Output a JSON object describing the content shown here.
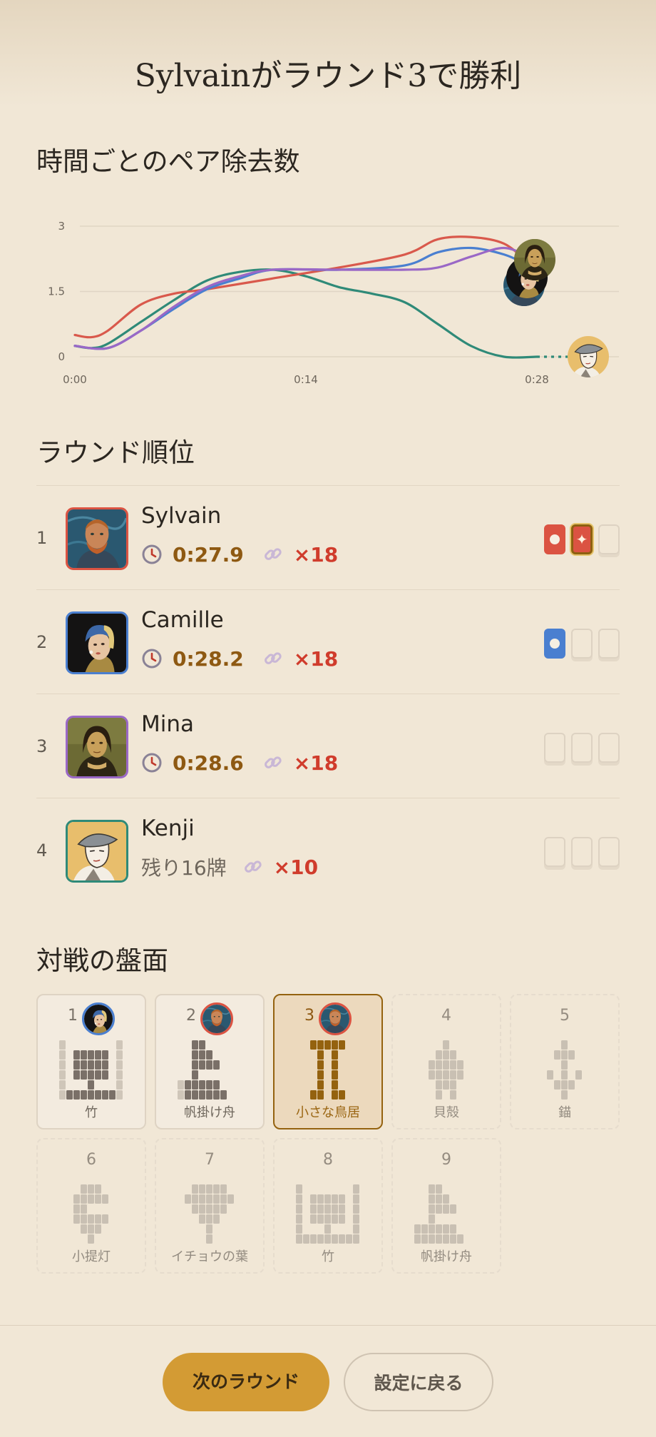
{
  "title": "Sylvainがラウンド3で勝利",
  "chart_section": {
    "heading": "時間ごとのペア除去数"
  },
  "chart_data": {
    "type": "line",
    "x_tick_labels": [
      "0:00",
      "0:14",
      "0:28"
    ],
    "y_tick_labels": [
      "0",
      "1.5",
      "3"
    ],
    "xlim": [
      0,
      28
    ],
    "ylim": [
      0,
      3
    ],
    "grid": true,
    "series": [
      {
        "player": "Sylvain",
        "color": "#d9594c",
        "x": [
          0,
          1,
          2,
          4,
          6,
          8,
          12,
          16,
          20,
          22,
          24,
          26,
          27.5
        ],
        "y": [
          0.5,
          0.45,
          0.6,
          1.2,
          1.45,
          1.55,
          1.8,
          2.05,
          2.35,
          2.7,
          2.75,
          2.6,
          2.15
        ]
      },
      {
        "player": "Camille",
        "color": "#4a7fd0",
        "x": [
          0,
          2,
          4,
          6,
          8,
          10,
          12,
          16,
          20,
          22,
          24,
          26,
          27.5
        ],
        "y": [
          0.25,
          0.2,
          0.6,
          1.1,
          1.55,
          1.8,
          2.0,
          2.0,
          2.1,
          2.4,
          2.5,
          2.35,
          2.1
        ]
      },
      {
        "player": "Mina",
        "color": "#9a68c6",
        "x": [
          0,
          2,
          4,
          6,
          8,
          10,
          12,
          16,
          20,
          22,
          24,
          26,
          27.5
        ],
        "y": [
          0.25,
          0.2,
          0.6,
          1.15,
          1.6,
          1.85,
          2.0,
          2.0,
          2.0,
          2.05,
          2.3,
          2.5,
          2.3
        ]
      },
      {
        "player": "Kenji",
        "color": "#2f8a78",
        "x": [
          0,
          1,
          2,
          4,
          6,
          8,
          10,
          12,
          14,
          16,
          18,
          20,
          22,
          24,
          26,
          28
        ],
        "y": [
          0.25,
          0.2,
          0.3,
          0.8,
          1.3,
          1.75,
          1.95,
          2.0,
          1.85,
          1.6,
          1.45,
          1.25,
          0.75,
          0.25,
          0.0,
          0.0
        ]
      }
    ]
  },
  "ranking_section": {
    "heading": "ラウンド順位"
  },
  "players": [
    {
      "rank": "1",
      "name": "Sylvain",
      "time": "0:27.9",
      "mult": "×18",
      "remaining": "",
      "accent": "#db5342"
    },
    {
      "rank": "2",
      "name": "Camille",
      "time": "0:28.2",
      "mult": "×18",
      "remaining": "",
      "accent": "#4a7fd0"
    },
    {
      "rank": "3",
      "name": "Mina",
      "time": "0:28.6",
      "mult": "×18",
      "remaining": "",
      "accent": "#9a68c6"
    },
    {
      "rank": "4",
      "name": "Kenji",
      "time": "",
      "mult": "×10",
      "remaining": "残り16牌",
      "accent": "#2f8a78"
    }
  ],
  "win_boxes": [
    [
      "win",
      "star-win",
      "empty"
    ],
    [
      "win",
      "empty",
      "empty"
    ],
    [
      "empty",
      "empty",
      "empty"
    ],
    [
      "empty",
      "empty",
      "empty"
    ]
  ],
  "boards_section": {
    "heading": "対戦の盤面"
  },
  "boards": [
    {
      "num": "1",
      "name": "竹",
      "state": "played",
      "winner": "Camille"
    },
    {
      "num": "2",
      "name": "帆掛け舟",
      "state": "played",
      "winner": "Sylvain"
    },
    {
      "num": "3",
      "name": "小さな鳥居",
      "state": "current",
      "winner": "Sylvain"
    },
    {
      "num": "4",
      "name": "貝殻",
      "state": "future",
      "winner": ""
    },
    {
      "num": "5",
      "name": "錨",
      "state": "future",
      "winner": ""
    },
    {
      "num": "6",
      "name": "小提灯",
      "state": "future",
      "winner": ""
    },
    {
      "num": "7",
      "name": "イチョウの葉",
      "state": "future",
      "winner": ""
    },
    {
      "num": "8",
      "name": "竹",
      "state": "future",
      "winner": ""
    },
    {
      "num": "9",
      "name": "帆掛け舟",
      "state": "future",
      "winner": ""
    }
  ],
  "footer": {
    "next_label": "次のラウンド",
    "back_label": "設定に戻る"
  },
  "icons": {
    "clock": "clock-icon",
    "pairs": "link-icon",
    "win_box": "circle-mark",
    "star_win": "sparkle-mark"
  }
}
